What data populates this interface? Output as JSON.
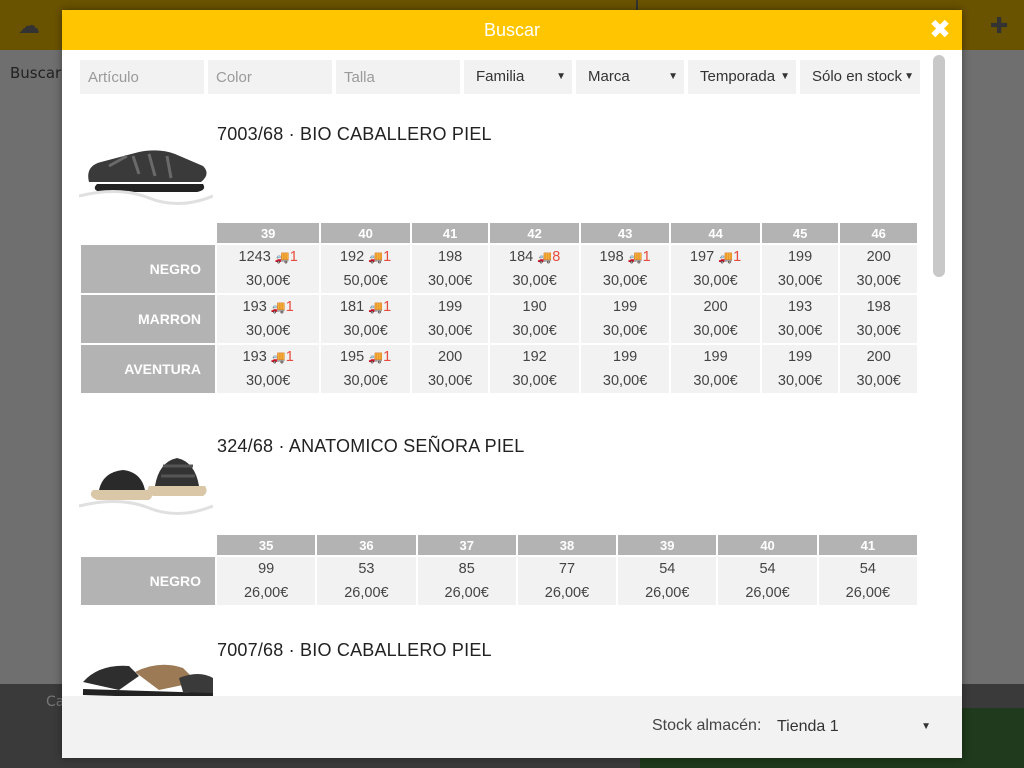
{
  "background": {
    "search_label": "Buscar",
    "bottom_label": "Ca"
  },
  "modal": {
    "title": "Buscar",
    "filters": {
      "articulo_placeholder": "Artículo",
      "color_placeholder": "Color",
      "talla_placeholder": "Talla",
      "familia": "Familia",
      "marca": "Marca",
      "temporada": "Temporada",
      "stock": "Sólo en stock"
    },
    "products": [
      {
        "title": "7003/68 · BIO CABALLERO PIEL",
        "sizes": [
          "39",
          "40",
          "41",
          "42",
          "43",
          "44",
          "45",
          "46"
        ],
        "rows": [
          {
            "color": "NEGRO",
            "cells": [
              {
                "stock": "1243",
                "incoming": "1",
                "price": "30,00€"
              },
              {
                "stock": "192",
                "incoming": "1",
                "price": "50,00€"
              },
              {
                "stock": "198",
                "incoming": "",
                "price": "30,00€"
              },
              {
                "stock": "184",
                "incoming": "8",
                "price": "30,00€"
              },
              {
                "stock": "198",
                "incoming": "1",
                "price": "30,00€"
              },
              {
                "stock": "197",
                "incoming": "1",
                "price": "30,00€"
              },
              {
                "stock": "199",
                "incoming": "",
                "price": "30,00€"
              },
              {
                "stock": "200",
                "incoming": "",
                "price": "30,00€"
              }
            ]
          },
          {
            "color": "MARRON",
            "cells": [
              {
                "stock": "193",
                "incoming": "1",
                "price": "30,00€"
              },
              {
                "stock": "181",
                "incoming": "1",
                "price": "30,00€"
              },
              {
                "stock": "199",
                "incoming": "",
                "price": "30,00€"
              },
              {
                "stock": "190",
                "incoming": "",
                "price": "30,00€"
              },
              {
                "stock": "199",
                "incoming": "",
                "price": "30,00€"
              },
              {
                "stock": "200",
                "incoming": "",
                "price": "30,00€"
              },
              {
                "stock": "193",
                "incoming": "",
                "price": "30,00€"
              },
              {
                "stock": "198",
                "incoming": "",
                "price": "30,00€"
              }
            ]
          },
          {
            "color": "AVENTURA",
            "cells": [
              {
                "stock": "193",
                "incoming": "1",
                "price": "30,00€"
              },
              {
                "stock": "195",
                "incoming": "1",
                "price": "30,00€"
              },
              {
                "stock": "200",
                "incoming": "",
                "price": "30,00€"
              },
              {
                "stock": "192",
                "incoming": "",
                "price": "30,00€"
              },
              {
                "stock": "199",
                "incoming": "",
                "price": "30,00€"
              },
              {
                "stock": "199",
                "incoming": "",
                "price": "30,00€"
              },
              {
                "stock": "199",
                "incoming": "",
                "price": "30,00€"
              },
              {
                "stock": "200",
                "incoming": "",
                "price": "30,00€"
              }
            ]
          }
        ]
      },
      {
        "title": "324/68 · ANATOMICO SEÑORA PIEL",
        "sizes": [
          "35",
          "36",
          "37",
          "38",
          "39",
          "40",
          "41"
        ],
        "rows": [
          {
            "color": "NEGRO",
            "cells": [
              {
                "stock": "99",
                "incoming": "",
                "price": "26,00€"
              },
              {
                "stock": "53",
                "incoming": "",
                "price": "26,00€"
              },
              {
                "stock": "85",
                "incoming": "",
                "price": "26,00€"
              },
              {
                "stock": "77",
                "incoming": "",
                "price": "26,00€"
              },
              {
                "stock": "54",
                "incoming": "",
                "price": "26,00€"
              },
              {
                "stock": "54",
                "incoming": "",
                "price": "26,00€"
              },
              {
                "stock": "54",
                "incoming": "",
                "price": "26,00€"
              }
            ]
          }
        ]
      },
      {
        "title": "7007/68 · BIO CABALLERO PIEL",
        "sizes": [],
        "rows": []
      }
    ],
    "footer": {
      "stock_label": "Stock almacén:",
      "store": "Tienda 1"
    },
    "colors": {
      "header": "#ffc600",
      "incoming": "#e74c3c",
      "size_header": "#b3b3b3"
    }
  }
}
